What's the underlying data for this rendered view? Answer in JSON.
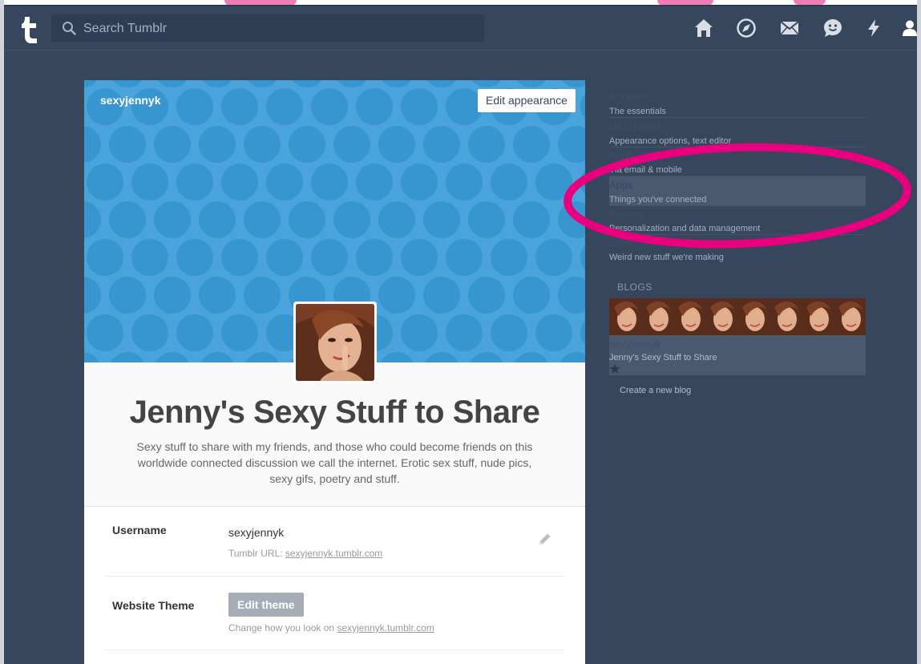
{
  "search": {
    "placeholder": "Search Tumblr"
  },
  "blog": {
    "handle": "sexyjennyk",
    "edit_appearance_label": "Edit appearance",
    "title": "Jenny's Sexy Stuff to Share",
    "description": "Sexy stuff to share with my friends, and those who could become friends on this worldwide connected discussion we call the internet. Erotic sex stuff, nude pics, sexy gifs, poetry and stuff."
  },
  "settings": {
    "username_label": "Username",
    "username_value": "sexyjennyk",
    "url_prefix": "Tumblr URL:",
    "url": "sexyjennyk.tumblr.com",
    "theme_label": "Website Theme",
    "edit_theme_label": "Edit theme",
    "theme_hint_prefix": "Change how you look on",
    "theme_hint_url": "sexyjennyk.tumblr.com"
  },
  "sidebar": {
    "items": [
      {
        "title": "Account",
        "subtitle": "The essentials"
      },
      {
        "title": "Dashboard",
        "subtitle": "Appearance options, text editor"
      },
      {
        "title": "Notifications",
        "subtitle": "Via email & mobile"
      },
      {
        "title": "Apps",
        "subtitle": "Things you've connected"
      },
      {
        "title": "Privacy",
        "subtitle": "Personalization and data management"
      },
      {
        "title": "Labs",
        "subtitle": "Weird new stuff we're making"
      }
    ],
    "blogs_heading": "BLOGS",
    "blog_name": "sexyjennyk",
    "blog_title": "Jenny's Sexy Stuff to Share",
    "create_blog": "Create a new blog"
  },
  "colors": {
    "background": "#36465d",
    "header_blue": "#4aa3db",
    "annotation_pink": "#e8007e"
  },
  "icons": [
    "tumblr-logo-icon",
    "search-icon",
    "home-icon",
    "explore-icon",
    "mail-icon",
    "messaging-icon",
    "activity-icon",
    "account-icon",
    "pencil-icon",
    "star-icon"
  ]
}
